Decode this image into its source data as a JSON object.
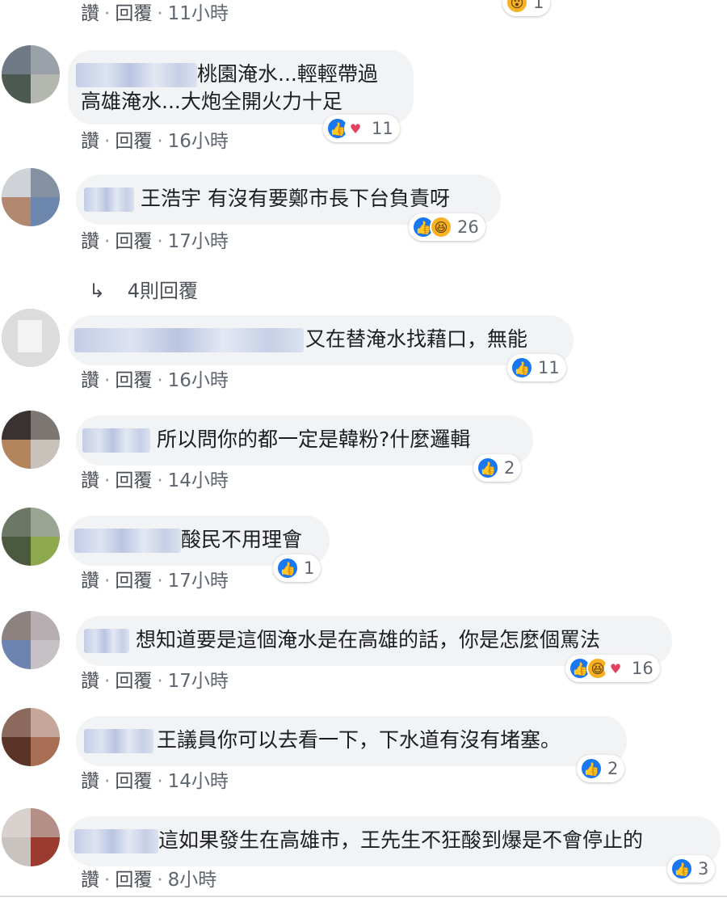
{
  "top_actions": {
    "like": "讚",
    "reply": "回覆",
    "time": "11小時",
    "reaction_count": "1"
  },
  "comments": [
    {
      "text_line1": "桃園淹水...輕輕帶過",
      "text_line2": "高雄淹水...大炮全開火力十足",
      "like": "讚",
      "reply": "回覆",
      "time": "16小時",
      "reaction_count": "11"
    },
    {
      "text_line1": "王浩宇 有沒有要鄭市長下台負責呀",
      "like": "讚",
      "reply": "回覆",
      "time": "17小時",
      "reaction_count": "26"
    },
    {
      "text_line1": "又在替淹水找藉口，無能",
      "like": "讚",
      "reply": "回覆",
      "time": "16小時",
      "reaction_count": "11"
    },
    {
      "text_line1": "所以問你的都一定是韓粉?什麼邏輯",
      "like": "讚",
      "reply": "回覆",
      "time": "14小時",
      "reaction_count": "2"
    },
    {
      "text_line1": "酸民不用理會",
      "like": "讚",
      "reply": "回覆",
      "time": "17小時",
      "reaction_count": "1"
    },
    {
      "text_line1": "想知道要是這個淹水是在高雄的話，你是怎麼個罵法",
      "like": "讚",
      "reply": "回覆",
      "time": "17小時",
      "reaction_count": "16"
    },
    {
      "text_line1": "王議員你可以去看一下，下水道有沒有堵塞。",
      "like": "讚",
      "reply": "回覆",
      "time": "14小時",
      "reaction_count": "2"
    },
    {
      "text_line1": "這如果發生在高雄市，王先生不狂酸到爆是不會停止的",
      "like": "讚",
      "reply": "回覆",
      "time": "8小時",
      "reaction_count": "3"
    }
  ],
  "replies_link": "4則回覆",
  "icons": {
    "reply_arrow": "↳"
  },
  "colors": {
    "like": "#1877f2",
    "haha": "#f7b125",
    "love": "#e4405f",
    "bubble": "#f2f3f5"
  }
}
